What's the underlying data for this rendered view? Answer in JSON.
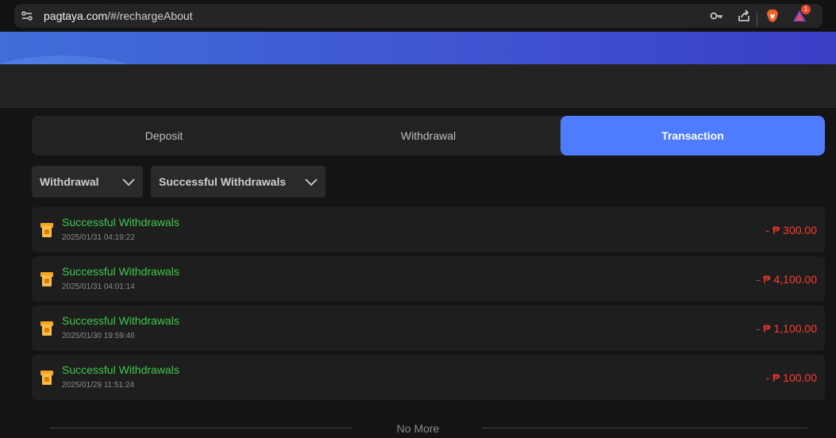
{
  "browser": {
    "url_host": "pagtaya.com",
    "url_path": "/#/rechargeAbout",
    "notification_count": "1",
    "icons": [
      "site-settings-icon",
      "key-icon",
      "share-icon",
      "brave-shield-icon",
      "brave-rewards-icon"
    ]
  },
  "colors": {
    "tab_active": "#4f7bff",
    "success_green": "#3ec94a",
    "amount_red": "#ff3b30",
    "banner_blue": "#4057d3"
  },
  "tabs": [
    {
      "label": "Deposit",
      "active": false
    },
    {
      "label": "Withdrawal",
      "active": false
    },
    {
      "label": "Transaction",
      "active": true
    }
  ],
  "filters": {
    "type": "Withdrawal",
    "status": "Successful Withdrawals"
  },
  "transactions": [
    {
      "title": "Successful Withdrawals",
      "time": "2025/01/31 04:19:22",
      "amount": "- ₱ 300.00"
    },
    {
      "title": "Successful Withdrawals",
      "time": "2025/01/31 04:01:14",
      "amount": "- ₱ 4,100.00"
    },
    {
      "title": "Successful Withdrawals",
      "time": "2025/01/30 19:59:46",
      "amount": "- ₱ 1,100.00"
    },
    {
      "title": "Successful Withdrawals",
      "time": "2025/01/29 11:51:24",
      "amount": "- ₱ 100.00"
    }
  ],
  "footer": {
    "no_more": "No More"
  }
}
